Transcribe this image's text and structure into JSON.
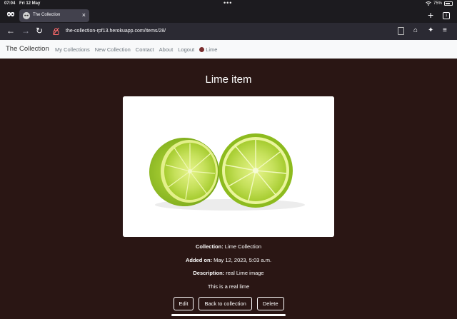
{
  "status_bar": {
    "time": "07:04",
    "date": "Fri 12 May",
    "battery_percent": "75%",
    "battery_level": 0.75,
    "icons": [
      "wifi-icon",
      "battery-icon"
    ]
  },
  "browser": {
    "tab": {
      "title": "The Collection"
    },
    "tab_count": "1",
    "url": "the-collection-rpf13.herokuapp.com/items/28/",
    "icons": [
      "private-browsing-icon",
      "back-icon",
      "forward-icon",
      "reload-icon",
      "lock-icon",
      "reader-icon",
      "home-icon",
      "extensions-icon",
      "menu-icon",
      "new-tab-icon",
      "close-icon"
    ]
  },
  "navbar": {
    "brand": "The Collection",
    "links": {
      "my_collections": "My Collections",
      "new_collection": "New Collection",
      "contact": "Contact",
      "about": "About",
      "logout": "Logout",
      "user": "Lime"
    }
  },
  "item": {
    "title": "Lime item",
    "image_alt": "real Lime image",
    "collection_label": "Collection:",
    "collection_value": "Lime Collection",
    "added_label": "Added on:",
    "added_value": "May 12, 2023, 5:03 a.m.",
    "description_label": "Description:",
    "description_value": "real Lime image",
    "notes": "This is a real lime"
  },
  "actions": {
    "edit": "Edit",
    "back": "Back to collection",
    "delete": "Delete"
  },
  "colors": {
    "page_background": "#2a1614",
    "navbar_background": "#f8f9fa",
    "browser_chrome": "#1c1b1f",
    "lime_green": "#9ccc2c"
  }
}
